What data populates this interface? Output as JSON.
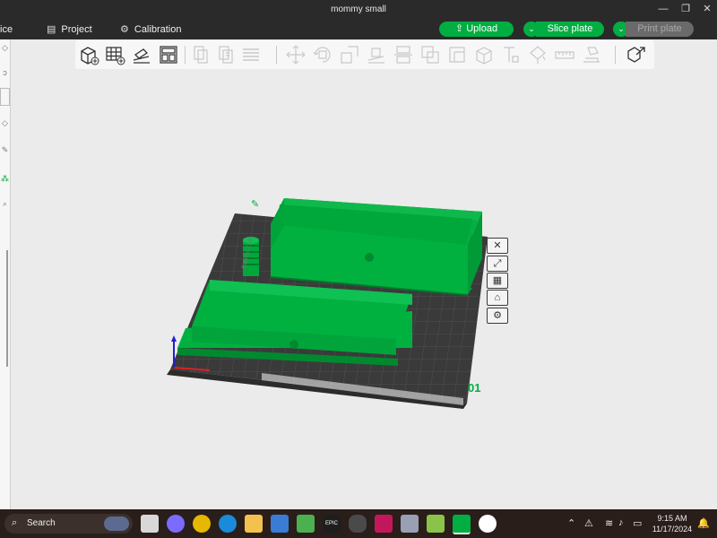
{
  "window": {
    "title": "mommy small"
  },
  "menu": {
    "tabs": [
      {
        "label": "ice"
      },
      {
        "label": "Project"
      },
      {
        "label": "Calibration"
      }
    ],
    "upload_label": "Upload",
    "slice_label": "Slice plate",
    "print_label": "Print plate"
  },
  "viewport": {
    "plate_number": "01",
    "plate_label": "Bambu Lab"
  },
  "taskbar": {
    "search_placeholder": "Search",
    "time": "9:15 AM",
    "date": "11/17/2024"
  },
  "colors": {
    "accent": "#00ae42",
    "model_green": "#00b140",
    "plate": "#3a3a3a",
    "titlebar": "#2a2a2a"
  }
}
